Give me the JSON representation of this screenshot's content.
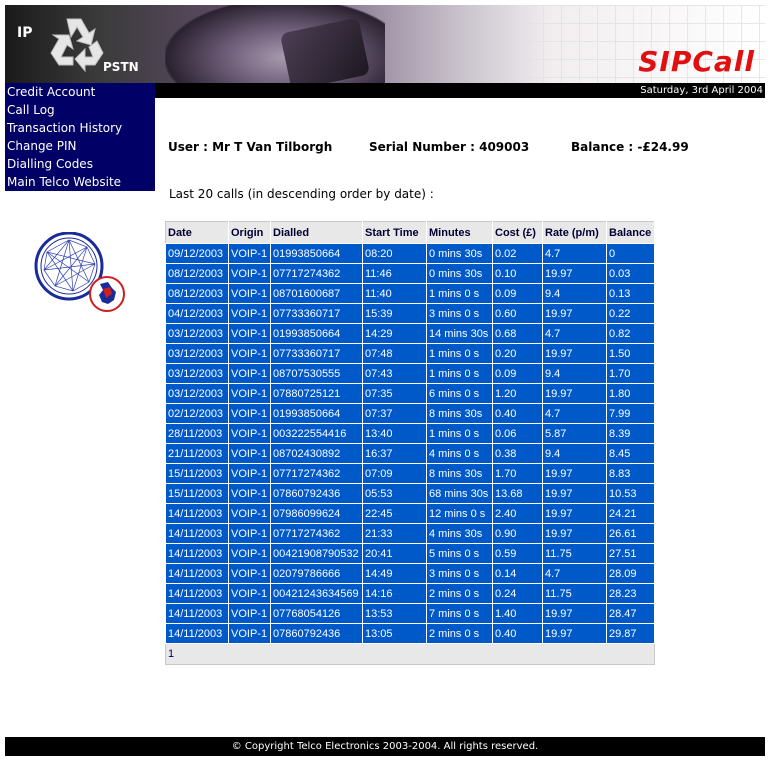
{
  "header": {
    "logo_ip": "IP",
    "logo_pstn": "PSTN",
    "brand": "SIPCall",
    "date": "Saturday, 3rd April 2004"
  },
  "nav": {
    "items": [
      {
        "label": "Credit Account"
      },
      {
        "label": "Call Log"
      },
      {
        "label": "Transaction History"
      },
      {
        "label": "Change PIN"
      },
      {
        "label": "Dialling Codes"
      },
      {
        "label": "Main Telco Website"
      }
    ]
  },
  "account": {
    "user": "User : Mr T Van Tilborgh",
    "serial": "Serial Number : 409003",
    "balance": "Balance : -£24.99"
  },
  "calls": {
    "heading": "Last 20 calls (in descending order by date) :",
    "columns": [
      "Date",
      "Origin",
      "Dialled",
      "Start Time",
      "Minutes",
      "Cost (£)",
      "Rate (p/m)",
      "Balance"
    ],
    "rows": [
      [
        "09/12/2003",
        "VOIP-1",
        "01993850664",
        "08:20",
        "0 mins 30s",
        "0.02",
        "4.7",
        "0"
      ],
      [
        "08/12/2003",
        "VOIP-1",
        "07717274362",
        "11:46",
        "0 mins 30s",
        "0.10",
        "19.97",
        "0.03"
      ],
      [
        "08/12/2003",
        "VOIP-1",
        "08701600687",
        "11:40",
        "1 mins 0 s",
        "0.09",
        "9.4",
        "0.13"
      ],
      [
        "04/12/2003",
        "VOIP-1",
        "07733360717",
        "15:39",
        "3 mins 0 s",
        "0.60",
        "19.97",
        "0.22"
      ],
      [
        "03/12/2003",
        "VOIP-1",
        "01993850664",
        "14:29",
        "14 mins 30s",
        "0.68",
        "4.7",
        "0.82"
      ],
      [
        "03/12/2003",
        "VOIP-1",
        "07733360717",
        "07:48",
        "1 mins 0 s",
        "0.20",
        "19.97",
        "1.50"
      ],
      [
        "03/12/2003",
        "VOIP-1",
        "08707530555",
        "07:43",
        "1 mins 0 s",
        "0.09",
        "9.4",
        "1.70"
      ],
      [
        "03/12/2003",
        "VOIP-1",
        "07880725121",
        "07:35",
        "6 mins 0 s",
        "1.20",
        "19.97",
        "1.80"
      ],
      [
        "02/12/2003",
        "VOIP-1",
        "01993850664",
        "07:37",
        "8 mins 30s",
        "0.40",
        "4.7",
        "7.99"
      ],
      [
        "28/11/2003",
        "VOIP-1",
        "003222554416",
        "13:40",
        "1 mins 0 s",
        "0.06",
        "5.87",
        "8.39"
      ],
      [
        "21/11/2003",
        "VOIP-1",
        "08702430892",
        "16:37",
        "4 mins 0 s",
        "0.38",
        "9.4",
        "8.45"
      ],
      [
        "15/11/2003",
        "VOIP-1",
        "07717274362",
        "07:09",
        "8 mins 30s",
        "1.70",
        "19.97",
        "8.83"
      ],
      [
        "15/11/2003",
        "VOIP-1",
        "07860792436",
        "05:53",
        "68 mins 30s",
        "13.68",
        "19.97",
        "10.53"
      ],
      [
        "14/11/2003",
        "VOIP-1",
        "07986099624",
        "22:45",
        "12 mins 0 s",
        "2.40",
        "19.97",
        "24.21"
      ],
      [
        "14/11/2003",
        "VOIP-1",
        "07717274362",
        "21:33",
        "4 mins 30s",
        "0.90",
        "19.97",
        "26.61"
      ],
      [
        "14/11/2003",
        "VOIP-1",
        "00421908790532",
        "20:41",
        "5 mins 0 s",
        "0.59",
        "11.75",
        "27.51"
      ],
      [
        "14/11/2003",
        "VOIP-1",
        "02079786666",
        "14:49",
        "3 mins 0 s",
        "0.14",
        "4.7",
        "28.09"
      ],
      [
        "14/11/2003",
        "VOIP-1",
        "00421243634569",
        "14:16",
        "2 mins 0 s",
        "0.24",
        "11.75",
        "28.23"
      ],
      [
        "14/11/2003",
        "VOIP-1",
        "07768054126",
        "13:53",
        "7 mins 0 s",
        "1.40",
        "19.97",
        "28.47"
      ],
      [
        "14/11/2003",
        "VOIP-1",
        "07860792436",
        "13:05",
        "2 mins 0 s",
        "0.40",
        "19.97",
        "29.87"
      ]
    ],
    "page": "1"
  },
  "footer": {
    "copyright": "© Copyright Telco Electronics 2003-2004. All rights reserved."
  },
  "icons": {
    "logo": "recycle-icon",
    "side_graphic": "network-globe-icon"
  },
  "colors": {
    "nav_bg": "#000066",
    "table_cell_bg": "#0059c9",
    "header_bg": "#e8e8e8",
    "brand_red": "#e01010"
  }
}
